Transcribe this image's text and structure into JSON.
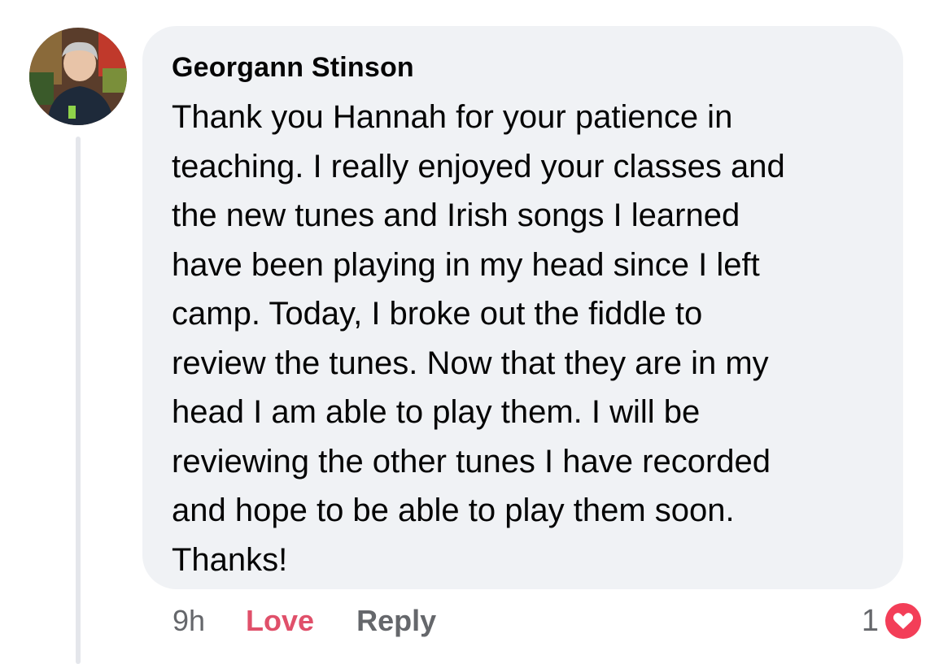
{
  "comment": {
    "author": "Georgann Stinson",
    "text": "Thank you Hannah for your patience in\nteaching. I really enjoyed your classes and\nthe new tunes and Irish songs I learned\nhave been playing in my head since I left\ncamp. Today, I broke out the fiddle to\nreview the tunes. Now that they are in my\nhead I am able to play them. I will be\nreviewing the other tunes I have recorded\nand hope to be able to play them soon.\nThanks!",
    "timestamp": "9h",
    "reaction_label": "Love",
    "reply_label": "Reply",
    "reaction_count": "1",
    "reaction_icon": "heart-icon"
  },
  "colors": {
    "bubble": "#f0f2f5",
    "love": "#e0506a",
    "muted": "#65676b",
    "heart": "#f33e58"
  }
}
